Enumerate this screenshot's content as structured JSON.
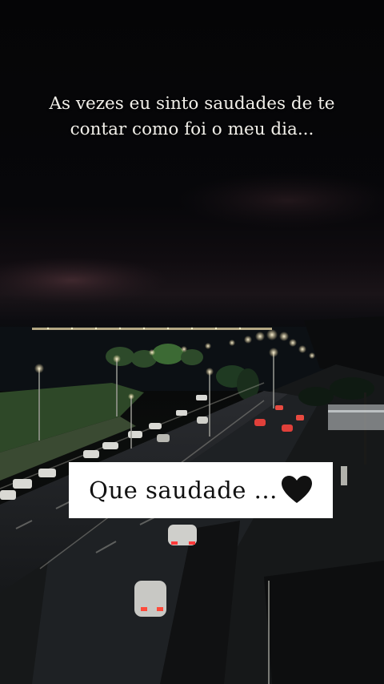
{
  "story": {
    "caption": "As vezes eu sinto saudades de te contar como foi o meu dia...",
    "sticker_text": "Que saudade ...",
    "sticker_icon": "black-heart-icon",
    "colors": {
      "caption": "#f2f0ea",
      "sticker_bg": "#ffffff",
      "sticker_text": "#111111",
      "heart": "#111111"
    }
  }
}
